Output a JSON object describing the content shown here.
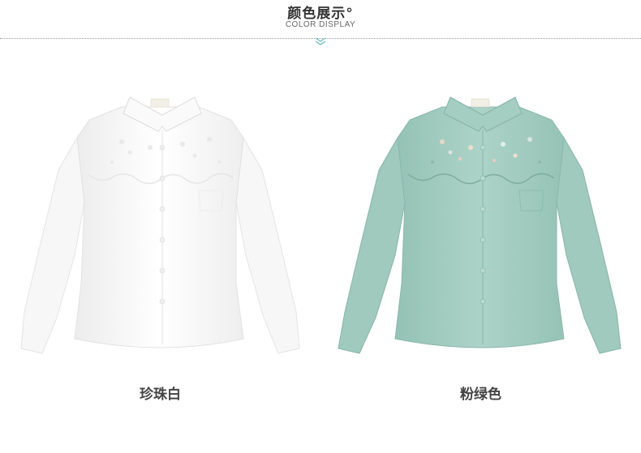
{
  "header": {
    "title": "颜色展示°",
    "subtitle": "COLOR DISPLAY"
  },
  "colors": {
    "white_shirt": "#ffffff",
    "green_shirt": "#a7cfc3"
  },
  "products": [
    {
      "label": "珍珠白"
    },
    {
      "label": "粉绿色"
    }
  ]
}
